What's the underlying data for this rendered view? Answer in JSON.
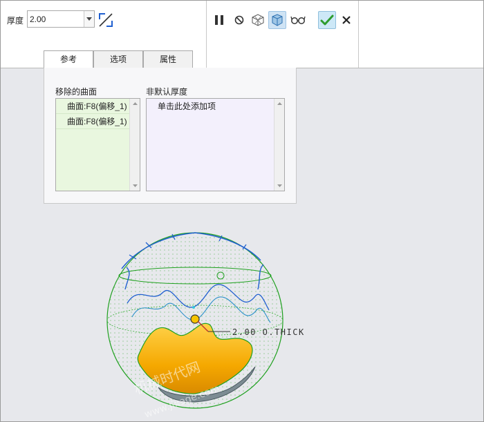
{
  "dashboard": {
    "thickness_label": "厚度",
    "thickness_value": "2.00",
    "flip_icon": "flip-direction-icon",
    "pause_icon": "pause-icon",
    "no_preview_icon": "no-preview-icon",
    "verify_icon": "verify-mode-icon",
    "feature_preview_icon": "feature-preview-icon",
    "glasses_icon": "glasses-icon",
    "ok_icon": "checkmark-icon",
    "cancel_icon": "close-icon"
  },
  "tabs": [
    {
      "label": "参考",
      "selected": true
    },
    {
      "label": "选项",
      "selected": false
    },
    {
      "label": "属性",
      "selected": false
    }
  ],
  "references": {
    "removed_surfaces_header": "移除的曲面",
    "removed_surfaces": [
      "曲面:F8(偏移_1)",
      "曲面:F8(偏移_1)"
    ],
    "non_default_header": "非默认厚度",
    "non_default_placeholder": "单击此处添加项"
  },
  "viewport": {
    "dimension_label": "2.00 O.THICK",
    "watermark_cn": "机械时代网",
    "watermark_url": "www.jixage.com"
  },
  "colors": {
    "removed_list_bg": "#e9f7df",
    "non_default_list_bg": "#f3f0fc",
    "shell_fill": "#f5a800",
    "wire_green": "#1fa01f",
    "curve_blue": "#1f5fd0",
    "accent_check": "#2e9c2e"
  }
}
